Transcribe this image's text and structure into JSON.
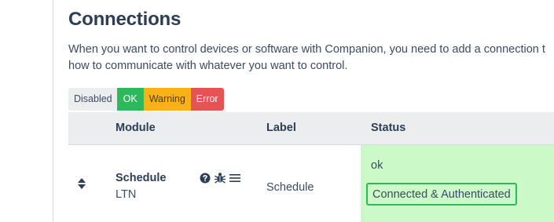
{
  "header": {
    "title": "Connections",
    "intro_line1": "When you want to control devices or software with Companion, you need to add a connection t",
    "intro_line2": "how to communicate with whatever you want to control."
  },
  "filters": {
    "disabled": "Disabled",
    "ok": "OK",
    "warning": "Warning",
    "error": "Error"
  },
  "table": {
    "columns": [
      "",
      "Module",
      "Label",
      "Status"
    ],
    "rows": [
      {
        "module_name": "Schedule",
        "module_sub": "LTN",
        "icons": [
          "help-icon",
          "bug-icon",
          "menu-icon"
        ],
        "label": "Schedule",
        "status": "ok",
        "status_message": "Connected & Authenticated"
      }
    ]
  },
  "colors": {
    "ok": "#2eb85c",
    "warning": "#f9b115",
    "error": "#e55353",
    "status_ok_bg": "#cbf9c7"
  }
}
